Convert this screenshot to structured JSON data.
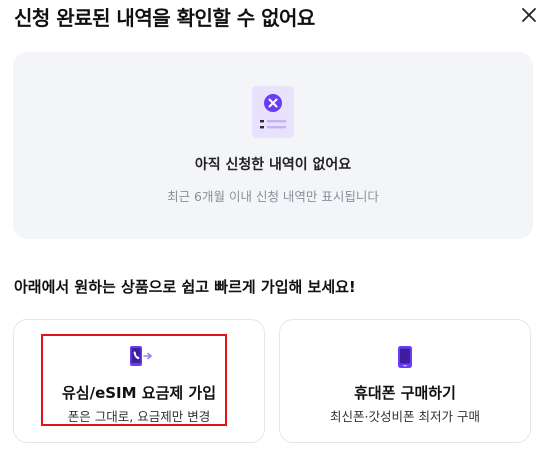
{
  "header": {
    "title": "신청 완료된 내역을 확인할 수 없어요",
    "close_icon": "close-icon"
  },
  "empty_state": {
    "icon": "document-x-icon",
    "title": "아직 신청한 내역이 없어요",
    "subtitle": "최근 6개월 이내 신청 내역만 표시됩니다"
  },
  "prompt": "아래에서 원하는 상품으로 쉽고 빠르게 가입해 보세요!",
  "options": [
    {
      "icon": "phone-transfer-icon",
      "title": "유심/eSIM 요금제 가입",
      "subtitle": "폰은 그대로, 요금제만 변경"
    },
    {
      "icon": "smartphone-icon",
      "title": "휴대폰 구매하기",
      "subtitle": "최신폰·갓성비폰 최저가 구매"
    }
  ],
  "colors": {
    "accent": "#6b3df2",
    "accent_light": "#e9e2fd",
    "highlight": "#e0121a",
    "box_bg": "#f4f5f8"
  }
}
